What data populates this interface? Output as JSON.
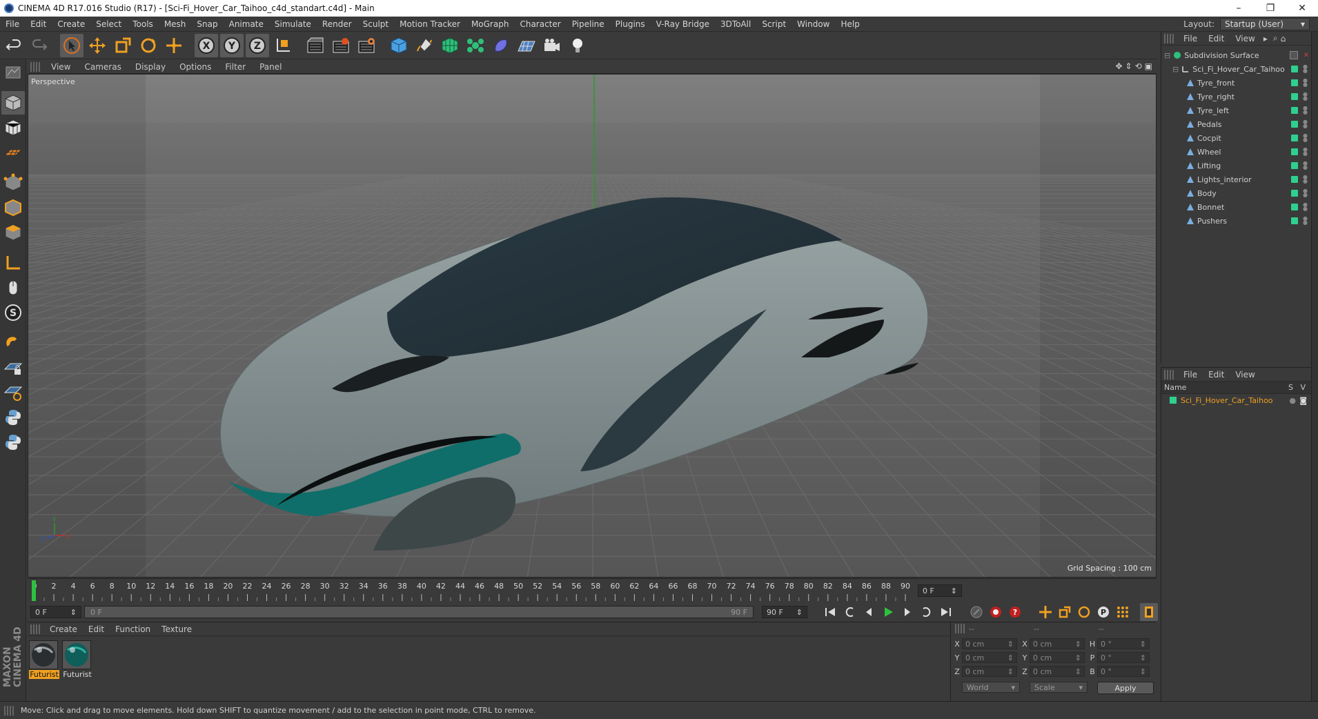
{
  "window": {
    "title": "CINEMA 4D R17.016 Studio (R17) - [Sci-Fi_Hover_Car_Taihoo_c4d_standart.c4d] - Main",
    "controls": [
      "–",
      "❐",
      "✕"
    ]
  },
  "menu": {
    "items": [
      "File",
      "Edit",
      "Create",
      "Select",
      "Tools",
      "Mesh",
      "Snap",
      "Animate",
      "Simulate",
      "Render",
      "Sculpt",
      "Motion Tracker",
      "MoGraph",
      "Character",
      "Pipeline",
      "Plugins",
      "V-Ray Bridge",
      "3DToAll",
      "Script",
      "Window",
      "Help"
    ],
    "layout_label": "Layout:",
    "layout_value": "Startup (User)"
  },
  "toolbar": {
    "icons": [
      "undo-icon",
      "redo-icon",
      "select-arrow-icon",
      "move-icon",
      "scale-icon",
      "rotate-icon",
      "live-transform-icon",
      "x-axis-icon",
      "y-axis-icon",
      "z-axis-icon",
      "coordinate-system-icon",
      "render-view-icon",
      "render-picture-viewer-icon",
      "render-settings-icon",
      "cube-icon",
      "pen-spline-icon",
      "subdivision-icon",
      "cloner-icon",
      "deformer-icon",
      "floor-icon",
      "camera-icon",
      "light-icon"
    ]
  },
  "viewport": {
    "menu": [
      "View",
      "Cameras",
      "Display",
      "Options",
      "Filter",
      "Panel"
    ],
    "label": "Perspective",
    "grid_spacing": "Grid Spacing : 100 cm",
    "car_colors": {
      "body": "#7f8c8d",
      "canopy": "#2a3a43",
      "accent": "#0f6e6a"
    }
  },
  "timeline": {
    "ticks": [
      "0",
      "2",
      "4",
      "6",
      "8",
      "10",
      "12",
      "14",
      "16",
      "18",
      "20",
      "22",
      "24",
      "26",
      "28",
      "30",
      "32",
      "34",
      "36",
      "38",
      "40",
      "42",
      "44",
      "46",
      "48",
      "50",
      "52",
      "54",
      "56",
      "58",
      "60",
      "62",
      "64",
      "66",
      "68",
      "70",
      "72",
      "74",
      "76",
      "78",
      "80",
      "82",
      "84",
      "86",
      "88",
      "90"
    ],
    "current_frame": "0 F",
    "start_field": "0 F",
    "range_start": "0 F",
    "range_end": "90 F",
    "end_field": "90 F"
  },
  "materials": {
    "menu": [
      "Create",
      "Edit",
      "Function",
      "Texture"
    ],
    "items": [
      {
        "name": "Futurist",
        "selected": true
      },
      {
        "name": "Futurist",
        "selected": false
      }
    ]
  },
  "coordinates": {
    "header": [
      "--",
      "--",
      "--"
    ],
    "rows": [
      {
        "a": "X",
        "v1": "0 cm",
        "b": "X",
        "v2": "0 cm",
        "c": "H",
        "v3": "0 °"
      },
      {
        "a": "Y",
        "v1": "0 cm",
        "b": "Y",
        "v2": "0 cm",
        "c": "P",
        "v3": "0 °"
      },
      {
        "a": "Z",
        "v1": "0 cm",
        "b": "Z",
        "v2": "0 cm",
        "c": "B",
        "v3": "0 °"
      }
    ],
    "mode": "World",
    "scale": "Scale",
    "apply": "Apply"
  },
  "object_manager": {
    "menu": [
      "File",
      "Edit",
      "View"
    ],
    "root": "Subdivision Surface",
    "group": "Sci_Fi_Hover_Car_Taihoo",
    "children": [
      "Tyre_front",
      "Tyre_right",
      "Tyre_left",
      "Pedals",
      "Cocpit",
      "Wheel",
      "Lifting",
      "Lights_interior",
      "Body",
      "Bonnet",
      "Pushers"
    ]
  },
  "layer_manager": {
    "menu": [
      "File",
      "Edit",
      "View"
    ],
    "col_name": "Name",
    "col_s": "S",
    "col_v": "V",
    "item": "Sci_Fi_Hover_Car_Taihoo"
  },
  "status": {
    "text": "Move: Click and drag to move elements. Hold down SHIFT to quantize movement / add to the selection in point mode, CTRL to remove."
  },
  "branding": {
    "logo": "MAXON CINEMA 4D"
  }
}
